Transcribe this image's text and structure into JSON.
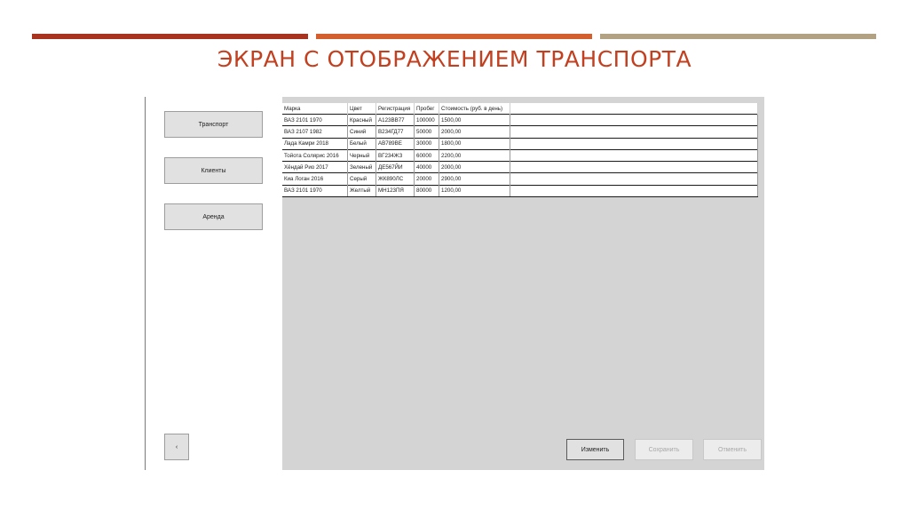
{
  "slide": {
    "title": "ЭКРАН С ОТОБРАЖЕНИЕМ ТРАНСПОРТА",
    "accent_colors": [
      "#a8341f",
      "#d35e2e",
      "#b3a183"
    ]
  },
  "sidebar": {
    "items": [
      {
        "label": "Транспорт"
      },
      {
        "label": "Клиенты"
      },
      {
        "label": "Аренда"
      }
    ],
    "back_label": "‹"
  },
  "table": {
    "columns": [
      "Марка",
      "Цвет",
      "Регистрация",
      "Пробег",
      "Стоимость (руб. в день)"
    ],
    "rows": [
      [
        "ВАЗ 2101 1970",
        "Красный",
        "А123ВВ77",
        "100000",
        "1500,00"
      ],
      [
        "ВАЗ 2107 1982",
        "Синий",
        "В234ГД77",
        "50000",
        "2000,00"
      ],
      [
        "Лада Камри 2018",
        "Белый",
        "АВ789ВЕ",
        "30000",
        "1800,00"
      ],
      [
        "Тойота Солярис 2016",
        "Черный",
        "ВГ234ЖЗ",
        "60000",
        "2200,00"
      ],
      [
        "Хёндай Рио 2017",
        "Зеленый",
        "ДЕ567ЙИ",
        "40000",
        "2000,00"
      ],
      [
        "Киа Логан 2016",
        "Серый",
        "ЖК890ЛС",
        "20000",
        "2900,00"
      ],
      [
        "ВАЗ 2101 1970",
        "Желтый",
        "МН123ПЯ",
        "80000",
        "1200,00"
      ]
    ]
  },
  "actions": {
    "edit_label": "Изменить",
    "save_label": "Сохранить",
    "cancel_label": "Отменить"
  }
}
